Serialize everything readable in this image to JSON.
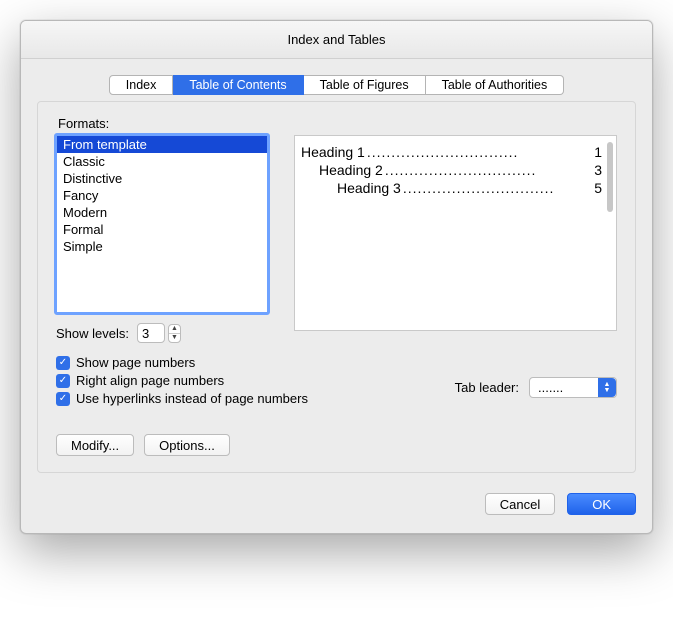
{
  "title": "Index and Tables",
  "tabs": [
    "Index",
    "Table of Contents",
    "Table of Figures",
    "Table of Authorities"
  ],
  "active_tab": 1,
  "formats_label": "Formats:",
  "formats": [
    "From template",
    "Classic",
    "Distinctive",
    "Fancy",
    "Modern",
    "Formal",
    "Simple"
  ],
  "selected_format": 0,
  "show_levels_label": "Show levels:",
  "show_levels_value": "3",
  "preview": [
    {
      "indent": 0,
      "label": "Heading 1",
      "page": "1"
    },
    {
      "indent": 1,
      "label": "Heading 2",
      "page": "3"
    },
    {
      "indent": 2,
      "label": "Heading 3",
      "page": "5"
    }
  ],
  "checks": {
    "show_page_numbers": {
      "label": "Show page numbers",
      "checked": true
    },
    "right_align": {
      "label": "Right align page numbers",
      "checked": true
    },
    "use_hyperlinks": {
      "label": "Use hyperlinks instead of page numbers",
      "checked": true
    }
  },
  "tab_leader_label": "Tab leader:",
  "tab_leader_value": ".......",
  "buttons": {
    "modify": "Modify...",
    "options": "Options...",
    "cancel": "Cancel",
    "ok": "OK"
  }
}
